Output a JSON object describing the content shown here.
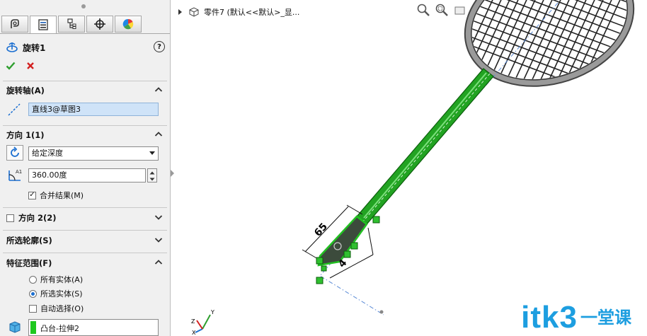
{
  "feature": {
    "title": "旋转1",
    "help_icon": "?"
  },
  "tabs": [
    {
      "name": "featuremanager",
      "icon": "featuremanager-icon"
    },
    {
      "name": "propertymanager",
      "icon": "propertymanager-icon",
      "active": true
    },
    {
      "name": "configurationmanager",
      "icon": "configurationmanager-icon"
    },
    {
      "name": "dimxpert",
      "icon": "dimxpert-icon"
    },
    {
      "name": "display",
      "icon": "display-manager-icon"
    }
  ],
  "sections": {
    "axis": {
      "label": "旋转轴(A)",
      "value": "直线3@草图3"
    },
    "dir1": {
      "label": "方向 1(1)",
      "type": "给定深度",
      "angle": "360.00度",
      "merge_label": "合并结果(M)",
      "merge_checked": true
    },
    "dir2": {
      "label": "方向 2(2)",
      "checked": false
    },
    "contours": {
      "label": "所选轮廓(S)"
    },
    "scope": {
      "label": "特征范围(F)",
      "opt_all": "所有实体(A)",
      "opt_selected": "所选实体(S)",
      "selected": "opt_selected",
      "auto_label": "自动选择(O)",
      "auto_checked": false,
      "body": "凸台-拉伸2"
    }
  },
  "viewport": {
    "breadcrumb": "零件7  (默认<<默认>_显...",
    "dims": {
      "length": "65",
      "diameter": "4"
    },
    "triad": {
      "x": "X",
      "y": "Y",
      "z": "Z"
    }
  },
  "watermark": {
    "latin": "itk3",
    "cn": "一堂课"
  },
  "colors": {
    "handle_green": "#1f9a1f",
    "watermark": "#1d9ee0",
    "selection_field": "#cfe3f8"
  }
}
